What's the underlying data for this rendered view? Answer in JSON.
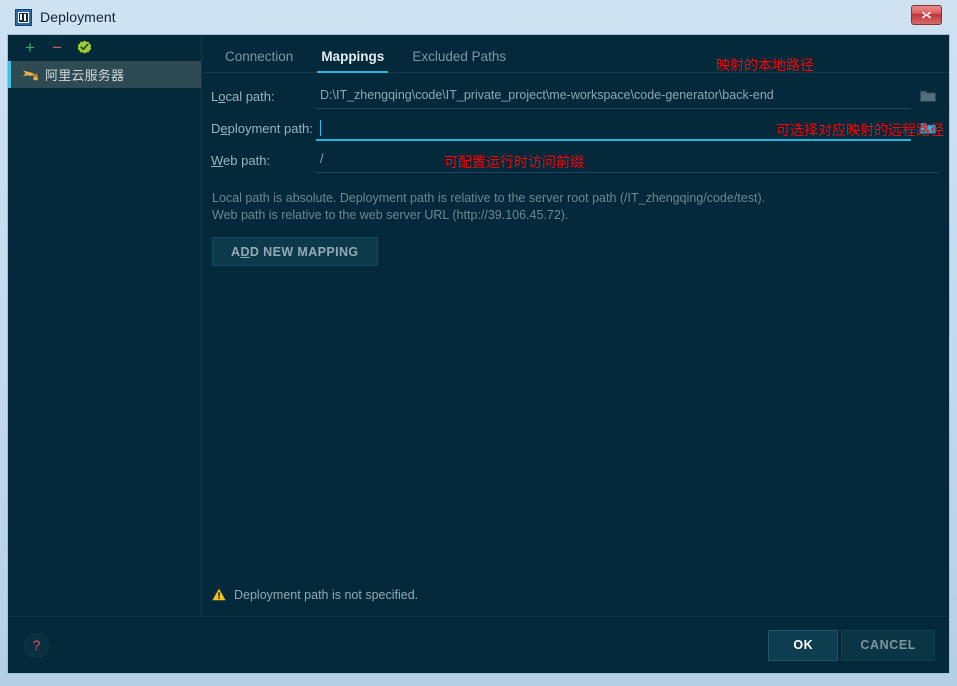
{
  "window": {
    "title": "Deployment",
    "app_icon": "intellij-idea-icon",
    "close_label": "✕"
  },
  "sidebar": {
    "toolbar": [
      {
        "name": "add-server-icon",
        "glyph": "+",
        "color": "#4ea36e"
      },
      {
        "name": "remove-server-icon",
        "glyph": "−",
        "color": "#c75b5b"
      },
      {
        "name": "validate-connection-icon",
        "glyph": "check-badge",
        "color": "#9ccc3a"
      }
    ],
    "servers": [
      {
        "label": "阿里云服务器",
        "icon": "sftp-server-icon",
        "selected": true
      }
    ]
  },
  "main": {
    "tabs": [
      {
        "label": "Connection",
        "active": false
      },
      {
        "label": "Mappings",
        "active": true
      },
      {
        "label": "Excluded Paths",
        "active": false
      }
    ],
    "fields": {
      "local_path": {
        "label_pre": "L",
        "label_mnemonic": "o",
        "label_post": "cal path:",
        "value": "D:\\IT_zhengqing\\code\\IT_private_project\\me-workspace\\code-generator\\back-end",
        "browse_icon": "folder-icon"
      },
      "deployment_path": {
        "label_pre": "D",
        "label_mnemonic": "e",
        "label_post": "ployment path:",
        "value": "",
        "browse_icon": "folder-icon"
      },
      "web_path": {
        "label_pre": "",
        "label_mnemonic": "W",
        "label_post": "eb path:",
        "value": "/"
      }
    },
    "annotations": {
      "local_path": "映射的本地路径",
      "deployment_path": "可选择对应映射的远程路径",
      "web_path": "可配置运行时访问前缀"
    },
    "hints": {
      "line1": "Local path is absolute. Deployment path is relative to the server root path (/IT_zhengqing/code/test).",
      "line2": "Web path is relative to the web server URL (http://39.106.45.72)."
    },
    "add_mapping": {
      "pre": "A",
      "mnemonic": "D",
      "post": "D NEW MAPPING"
    },
    "status": {
      "icon": "warning-icon",
      "text": "Deployment path is not specified."
    }
  },
  "footer": {
    "help_icon": "help-question-icon",
    "ok_label": "OK",
    "cancel_label": "CANCEL"
  },
  "colors": {
    "panel_background": "#03293a",
    "accent": "#27b4e0",
    "selection": "#2e4a52",
    "annotation": "#ff0000",
    "warning": "#f0c020"
  }
}
